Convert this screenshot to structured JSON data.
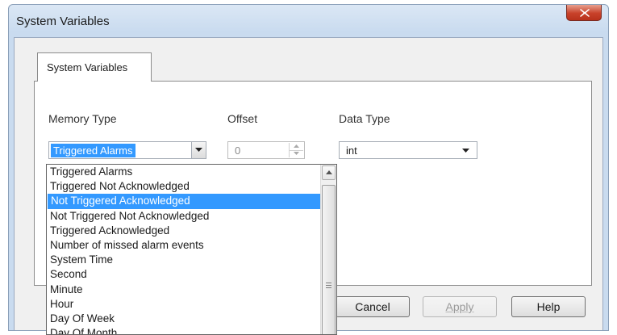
{
  "window": {
    "title": "System Variables"
  },
  "tab": {
    "label": "System Variables"
  },
  "fields": {
    "memory_type_label": "Memory Type",
    "offset_label": "Offset",
    "data_type_label": "Data Type",
    "memory_type_value": "Triggered Alarms",
    "offset_value": "0",
    "data_type_value": "int"
  },
  "dropdown": {
    "items": [
      "Triggered Alarms",
      "Triggered Not Acknowledged",
      "Not Triggered Acknowledged",
      "Not Triggered Not Acknowledged",
      "Triggered Acknowledged",
      "Number of missed alarm events",
      "System Time",
      "Second",
      "Minute",
      "Hour",
      "Day Of Week",
      "Day Of Month"
    ],
    "highlighted": "Not Triggered Acknowledged"
  },
  "buttons": {
    "cancel": "Cancel",
    "apply": "Apply",
    "help": "Help"
  },
  "colors": {
    "selection": "#3399ff",
    "close_button": "#c8412a"
  },
  "icons": [
    "close-icon",
    "dropdown-arrow-icon",
    "spin-up-icon",
    "spin-down-icon",
    "scroll-up-icon"
  ]
}
